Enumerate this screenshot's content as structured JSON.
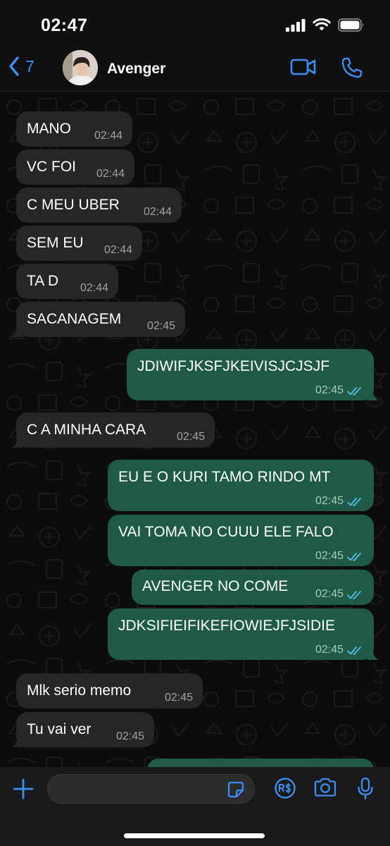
{
  "status": {
    "time": "02:47"
  },
  "header": {
    "back_count": "7",
    "contact_name": "Avenger"
  },
  "colors": {
    "accent": "#3b8ef3",
    "incoming": "#262628",
    "outgoing": "#1f5a47",
    "read_ticks": "#53bdeb"
  },
  "messages": [
    {
      "dir": "in",
      "text": "MANO",
      "time": "02:44"
    },
    {
      "dir": "in",
      "text": "VC FOI",
      "time": "02:44"
    },
    {
      "dir": "in",
      "text": "C MEU UBER",
      "time": "02:44"
    },
    {
      "dir": "in",
      "text": "SEM EU",
      "time": "02:44"
    },
    {
      "dir": "in",
      "text": "TA D",
      "time": "02:44"
    },
    {
      "dir": "in",
      "text": "SACANAGEM",
      "time": "02:45"
    },
    {
      "dir": "out",
      "text": "JDIWIFJKSFJKEIVISJCJSJF",
      "time": "02:45",
      "status": "read"
    },
    {
      "dir": "in",
      "text": "C A MINHA CARA",
      "time": "02:45"
    },
    {
      "dir": "out",
      "text": "EU E O KURI TAMO RINDO MT",
      "time": "02:45",
      "status": "read"
    },
    {
      "dir": "out",
      "text": "VAI TOMA NO CUUU ELE FALO",
      "time": "02:45",
      "status": "read"
    },
    {
      "dir": "out",
      "text": "AVENGER NO COME",
      "time": "02:45",
      "status": "read"
    },
    {
      "dir": "out",
      "text": "JDKSIFIEIFIKEFIOWIEJFJSIDIE",
      "time": "02:45",
      "status": "read"
    },
    {
      "dir": "in",
      "text": "Mlk serio memo",
      "time": "02:45"
    },
    {
      "dir": "in",
      "text": "Tu vai ver",
      "time": "02:45"
    }
  ],
  "composer": {
    "value": "",
    "placeholder": ""
  },
  "icons": [
    "back-chevron-icon",
    "video-call-icon",
    "phone-icon",
    "plus-icon",
    "sticker-icon",
    "payment-icon",
    "camera-icon",
    "microphone-icon",
    "signal-icon",
    "wifi-icon",
    "battery-icon",
    "read-ticks-icon"
  ]
}
